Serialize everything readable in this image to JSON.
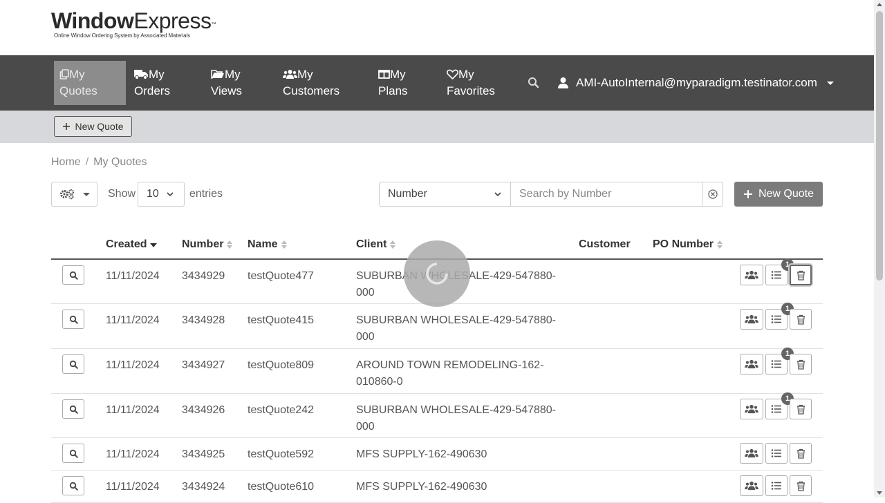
{
  "logo": {
    "word_bold": "Window",
    "word_light": "Express",
    "tm": "™",
    "tagline": "Online Window Ordering System by Associated Materials"
  },
  "nav": {
    "items": [
      {
        "line1": "My",
        "line2": "Quotes",
        "icon": "copy-icon"
      },
      {
        "line1": "My",
        "line2": "Orders",
        "icon": "truck-icon"
      },
      {
        "line1": "My",
        "line2": "Views",
        "icon": "folder-open-icon"
      },
      {
        "line1": "My",
        "line2": "Customers",
        "icon": "users-icon"
      },
      {
        "line1": "My",
        "line2": "Plans",
        "icon": "columns-icon"
      },
      {
        "line1": "My",
        "line2": "Favorites",
        "icon": "heart-icon"
      }
    ],
    "user_email": "AMI-AutoInternal@myparadigm.testinator.com"
  },
  "subbar": {
    "new_quote_label": "New Quote"
  },
  "breadcrumb": {
    "home": "Home",
    "separator": "/",
    "current": "My Quotes"
  },
  "toolbar": {
    "show_label": "Show",
    "entries_value": "10",
    "entries_label": "entries",
    "search_field": "Number",
    "search_placeholder": "Search by Number",
    "new_quote_label": "New Quote"
  },
  "table": {
    "columns": {
      "created": "Created",
      "number": "Number",
      "name": "Name",
      "client": "Client",
      "customer": "Customer",
      "po_number": "PO Number"
    },
    "rows": [
      {
        "created": "11/11/2024",
        "number": "3434929",
        "name": "testQuote477",
        "client_l1": "SUBURBAN WHOLESALE-429-547880-",
        "client_l2": "000",
        "badge": "1"
      },
      {
        "created": "11/11/2024",
        "number": "3434928",
        "name": "testQuote415",
        "client_l1": "SUBURBAN WHOLESALE-429-547880-",
        "client_l2": "000",
        "badge": "1"
      },
      {
        "created": "11/11/2024",
        "number": "3434927",
        "name": "testQuote809",
        "client_l1": "AROUND TOWN REMODELING-162-",
        "client_l2": "010860-0",
        "badge": "1"
      },
      {
        "created": "11/11/2024",
        "number": "3434926",
        "name": "testQuote242",
        "client_l1": "SUBURBAN WHOLESALE-429-547880-",
        "client_l2": "000",
        "badge": "1"
      },
      {
        "created": "11/11/2024",
        "number": "3434925",
        "name": "testQuote592",
        "client_l1": "MFS SUPPLY-162-490630",
        "client_l2": "",
        "badge": ""
      },
      {
        "created": "11/11/2024",
        "number": "3434924",
        "name": "testQuote610",
        "client_l1": "MFS SUPPLY-162-490630",
        "client_l2": "",
        "badge": ""
      }
    ]
  },
  "colors": {
    "navbar": "#4a4a4a",
    "nav_active": "#8c8c8c",
    "subbar": "#d6d8db",
    "primary_button": "#7b7b7b"
  }
}
